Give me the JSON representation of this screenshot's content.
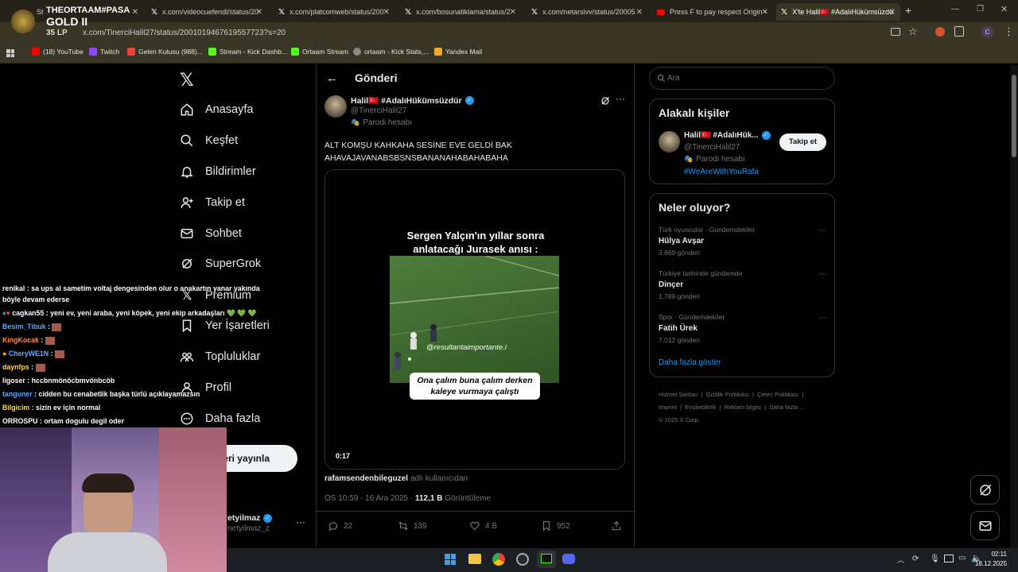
{
  "browser": {
    "tabs": [
      {
        "label": "St",
        "active": false
      },
      {
        "label": "x.com/videocuefendi/status/20",
        "active": false
      },
      {
        "label": "x.com/platcomweb/status/200",
        "active": false
      },
      {
        "label": "x.com/bosunatiklama/status/2",
        "active": false
      },
      {
        "label": "x.com/netarsivv/status/20005",
        "active": false
      },
      {
        "label": "Press F to pay respect Origin -",
        "active": false
      },
      {
        "label": "X'te Halil🇹🇷 #AdalıHükümsüzdü",
        "active": true
      }
    ],
    "url": "x.com/TinerciHalil27/status/2001019467619557723?s=20",
    "bookmarks": [
      {
        "label": "(18) YouTube",
        "color": "#ff0000"
      },
      {
        "label": "Twitch",
        "color": "#9146ff"
      },
      {
        "label": "Gelen Kutusu (988)...",
        "color": "#ea4335"
      },
      {
        "label": "Stream - Kick Dashb...",
        "color": "#53fc18"
      },
      {
        "label": "Ortaam Stream",
        "color": "#53fc18"
      },
      {
        "label": "ortaam - Kick Stats,...",
        "color": "#888888"
      },
      {
        "label": "Yandex Mail",
        "color": "#f5a623"
      }
    ]
  },
  "stream_overlay": {
    "name": "THEORTAAM#PASA",
    "rank": "GOLD II",
    "lp": "35 LP"
  },
  "nav": {
    "items": [
      {
        "label": "Anasayfa",
        "icon": "home-icon"
      },
      {
        "label": "Keşfet",
        "icon": "search-icon"
      },
      {
        "label": "Bildirimler",
        "icon": "bell-icon"
      },
      {
        "label": "Takip et",
        "icon": "follow-icon"
      },
      {
        "label": "Sohbet",
        "icon": "mail-icon"
      },
      {
        "label": "SuperGrok",
        "icon": "grok-icon"
      },
      {
        "label": "Premium",
        "icon": "x-icon"
      },
      {
        "label": "Yer İşaretleri",
        "icon": "bookmark-icon"
      },
      {
        "label": "Topluluklar",
        "icon": "communities-icon"
      },
      {
        "label": "Profil",
        "icon": "profile-icon"
      },
      {
        "label": "Daha fazla",
        "icon": "more-icon"
      }
    ],
    "post_button": "eri yayınla",
    "account_name": "etyilmaz",
    "account_handle": "netyilmaz_z"
  },
  "post": {
    "header": "Gönderi",
    "author_name": "Halil🇹🇷 #AdalıHükümsüzdür",
    "author_handle": "@TinerciHalil27",
    "parody_label": "Parodi hesabı",
    "text_line1": "ALT KOMŞU KAHKAHA SESİNE EVE GELDİ BAK",
    "text_line2": "AHAVAJAVANABSBSNSBANANAHABAHABAHA",
    "video": {
      "caption_top_line1": "Sergen Yalçın'ın yıllar sonra",
      "caption_top_line2": "anlatacağı Jurasek anısı :",
      "watermark": "@resultantaimportante.i",
      "caption_bottom_line1": "Ona çalım buna çalım derken",
      "caption_bottom_line2": "kaleye vurmaya çalıştı",
      "duration": "0:17"
    },
    "via_user": "rafamsendenbileguzel",
    "via_suffix": "adlı kullanıcıdan",
    "timestamp": "ÖS 10:59 · 16 Ara 2025 ·",
    "views_count": "112,1 B",
    "views_label": "Görüntüleme",
    "stats": {
      "replies": "22",
      "reposts": "139",
      "likes": "4 B",
      "bookmarks": "952"
    }
  },
  "sidebar": {
    "search_placeholder": "Ara",
    "related_title": "Alakalı kişiler",
    "related": {
      "name": "Halil🇹🇷 #AdalıHük...",
      "handle": "@TinerciHalil27",
      "parody": "Parodi hesabı",
      "bio": "#WeAreWithYouRafa",
      "follow_label": "Takip et"
    },
    "trends_title": "Neler oluyor?",
    "trends": [
      {
        "context": "Türk oyuncular · Gündemdekiler",
        "name": "Hülya Avşar",
        "count": "3.869 gönderi"
      },
      {
        "context": "Türkiye tarihinde gündemde",
        "name": "Dinçer",
        "count": "1.789 gönderi"
      },
      {
        "context": "Spor · Gündemdekiler",
        "name": "Fatih Ürek",
        "count": "7.012 gönderi"
      }
    ],
    "show_more": "Daha fazla göster",
    "footer_line1": [
      "Hizmet Şartları",
      "Gizlilik Politikası",
      "Çerez Politikası"
    ],
    "footer_line2": [
      "Imprint",
      "Erişilebilirlik",
      "Reklam bilgisi",
      "Daha fazla ..."
    ],
    "copyright": "© 2025 X Corp."
  },
  "chat": [
    {
      "user": "renikal",
      "color": "#ffffff",
      "msg": "sa ups al sametim voltaj dengesinden olur o anakartın yanar yakında"
    },
    {
      "user": "",
      "color": "#ffffff",
      "msg": "böyle devam ederse"
    },
    {
      "user": "cagkan55",
      "color": "#ffffff",
      "msg": "yeni ev, yeni araba, yeni köpek, yeni ekip arkadaşları 💚 💚 💚"
    },
    {
      "user": "Besim_Tibuk",
      "color": "#5fa8ff",
      "msg": ""
    },
    {
      "user": "KingKocak",
      "color": "#ff8c3a",
      "msg": ""
    },
    {
      "user": "CheryWE1N",
      "color": "#5fa8ff",
      "msg": ""
    },
    {
      "user": "daynfps",
      "color": "#ffd84a",
      "msg": ""
    },
    {
      "user": "ligoser",
      "color": "#ffffff",
      "msg": "hccbnmönöcbmvönbcöb"
    },
    {
      "user": "tanguner",
      "color": "#5fa8ff",
      "msg": "cidden bu cenabetlik başka türlü açıklayamazsın"
    },
    {
      "user": "Bilgicim",
      "color": "#ffd84a",
      "msg": "sizin ev için normal"
    },
    {
      "user": "ORROSPU",
      "color": "#ffffff",
      "msg": "ortam dogulu degil oder"
    }
  ],
  "taskbar": {
    "time": "02:11",
    "date": "18.12.2025"
  }
}
